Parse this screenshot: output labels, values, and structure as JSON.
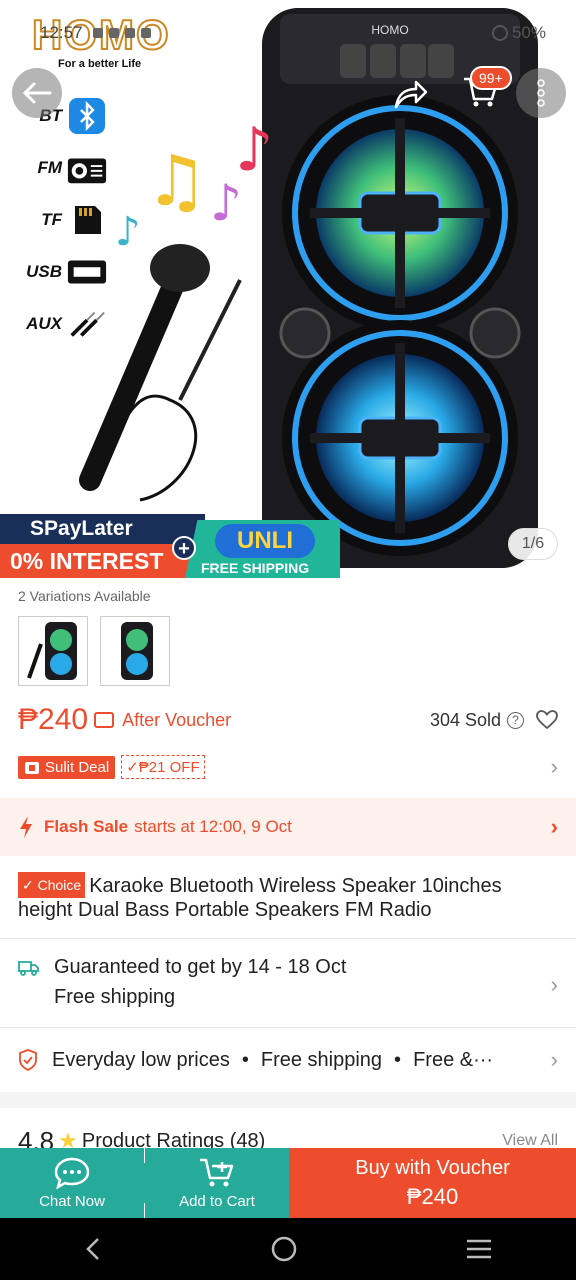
{
  "status_bar": {
    "time": "12:57",
    "battery": "50%"
  },
  "brand": {
    "name": "HOMO",
    "tagline": "For a better Life"
  },
  "header": {
    "cart_badge": "99+"
  },
  "features": [
    {
      "label": "BT",
      "icon": "bluetooth-icon"
    },
    {
      "label": "FM",
      "icon": "radio-icon"
    },
    {
      "label": "TF",
      "icon": "sd-card-icon"
    },
    {
      "label": "USB",
      "icon": "usb-icon"
    },
    {
      "label": "AUX",
      "icon": "aux-cable-icon"
    }
  ],
  "speaker_label": "HOMO",
  "promo": {
    "spay_title": "SPayLater",
    "spay_sub": "0% INTEREST",
    "unli_title": "UNLI",
    "unli_sub": "FREE SHIPPING"
  },
  "image_counter": "1/6",
  "variations": {
    "title": "2 Variations Available",
    "count": 2
  },
  "pricing": {
    "price": "₱240",
    "after_voucher": "After Voucher",
    "sold": "304 Sold"
  },
  "deal": {
    "sulit_label": "Sulit Deal",
    "off_label": "₱21 OFF"
  },
  "flash_sale": {
    "bold": "Flash Sale",
    "rest": "starts at 12:00, 9 Oct"
  },
  "product": {
    "choice_label": "Choice",
    "title": "Karaoke Bluetooth Wireless Speaker 10inches height Dual Bass Portable Speakers FM Radio"
  },
  "shipping": {
    "line1": "Guaranteed to get by 14 - 18 Oct",
    "line2": "Free shipping"
  },
  "perks": [
    "Everyday low prices",
    "Free shipping",
    "Free &···"
  ],
  "ratings": {
    "score": "4.8",
    "label": "Product Ratings (48)",
    "view_all": "View All"
  },
  "action_bar": {
    "chat": "Chat Now",
    "cart": "Add to Cart",
    "buy_label": "Buy with Voucher",
    "buy_price": "₱240"
  },
  "colors": {
    "accent": "#ee4d2d",
    "teal": "#26aa99",
    "star": "#ffce3d"
  }
}
